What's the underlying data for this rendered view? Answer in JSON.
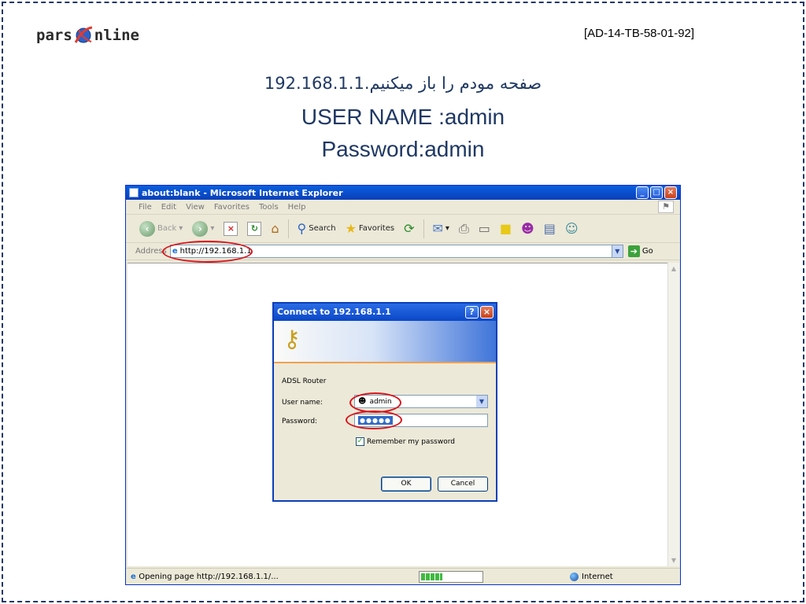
{
  "slide": {
    "logo_left": "pars",
    "logo_right": "nline",
    "doc_code": "[AD-14-TB-58-01-92]",
    "instruction_fa": "صفحه مودم را باز میکنیم.192.168.1.1",
    "instruction_user": "USER NAME :admin",
    "instruction_pass": "Password:admin"
  },
  "browser": {
    "title": "about:blank - Microsoft Internet Explorer",
    "menu": [
      "File",
      "Edit",
      "View",
      "Favorites",
      "Tools",
      "Help"
    ],
    "toolbar": {
      "back": "Back",
      "search": "Search",
      "favorites": "Favorites"
    },
    "address_label": "Address",
    "address_value": "http://192.168.1.1",
    "go_label": "Go",
    "status_text": "Opening page http://192.168.1.1/...",
    "zone": "Internet",
    "progress": 0.35
  },
  "dialog": {
    "title": "Connect to 192.168.1.1",
    "site": "ADSL Router",
    "user_label": "User name:",
    "user_value": "admin",
    "pass_label": "Password:",
    "pass_value": "●●●●●",
    "remember_label": "Remember my password",
    "ok": "OK",
    "cancel": "Cancel"
  },
  "colors": {
    "highlight": "#d9141b",
    "xp_blue": "#0a47c7",
    "title_text": "#1f3864"
  }
}
